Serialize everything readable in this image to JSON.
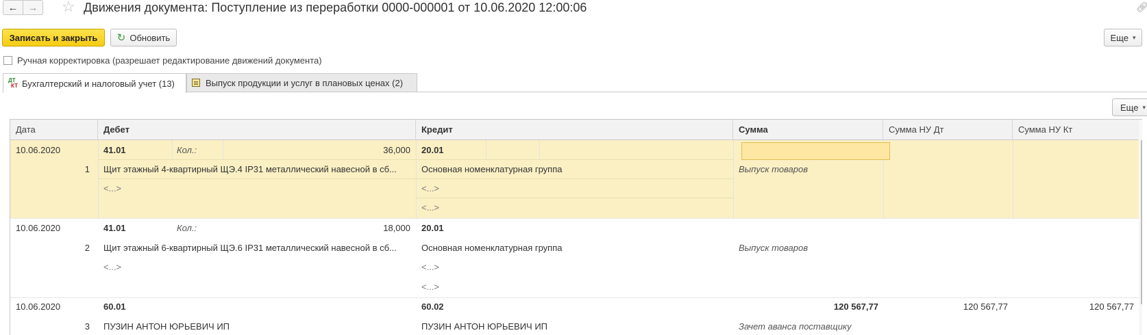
{
  "window": {
    "title": "Движения документа: Поступление из переработки 0000-000001 от 10.06.2020 12:00:06",
    "back_icon": "arrow-left-icon",
    "forward_icon": "arrow-right-icon",
    "favorite_icon": "star-icon",
    "link_icon": "link-icon"
  },
  "toolbar": {
    "save_close_label": "Записать и закрыть",
    "refresh_label": "Обновить",
    "more_label": "Еще"
  },
  "manual_edit": {
    "checked": false,
    "label": "Ручная корректировка (разрешает редактирование движений документа)"
  },
  "tabs": [
    {
      "label": "Бухгалтерский и налоговый учет (13)",
      "icon": "dt-kt-icon",
      "active": true
    },
    {
      "label": "Выпуск продукции и услуг в плановых ценах (2)",
      "icon": "document-icon",
      "active": false
    }
  ],
  "grid": {
    "more_label": "Еще",
    "columns": [
      "Дата",
      "Дебет",
      "Кредит",
      "Сумма",
      "Сумма НУ Дт",
      "Сумма НУ Кт"
    ],
    "rows": [
      {
        "date": "10.06.2020",
        "num": "1",
        "debit_account": "41.01",
        "qty_label": "Кол.:",
        "qty": "36,000",
        "debit_sub1": "Щит этажный 4-квартирный ЩЭ.4 IP31 металлический навесной в сб...",
        "debit_sub2": "<...>",
        "credit_account": "20.01",
        "credit_sub1": "Основная номенклатурная группа",
        "credit_sub2": "<...>",
        "credit_sub3": "<...>",
        "sum": "",
        "sum_desc": "Выпуск товаров",
        "nu_dt": "",
        "nu_kt": ""
      },
      {
        "date": "10.06.2020",
        "num": "2",
        "debit_account": "41.01",
        "qty_label": "Кол.:",
        "qty": "18,000",
        "debit_sub1": "Щит этажный 6-квартирный ЩЭ.6 IP31 металлический навесной в сб...",
        "debit_sub2": "<...>",
        "credit_account": "20.01",
        "credit_sub1": "Основная номенклатурная группа",
        "credit_sub2": "<...>",
        "credit_sub3": "<...>",
        "sum": "",
        "sum_desc": "Выпуск товаров",
        "nu_dt": "",
        "nu_kt": ""
      },
      {
        "date": "10.06.2020",
        "num": "3",
        "debit_account": "60.01",
        "debit_sub1": "ПУЗИН АНТОН ЮРЬЕВИЧ ИП",
        "credit_account": "60.02",
        "credit_sub1": "ПУЗИН АНТОН ЮРЬЕВИЧ ИП",
        "sum": "120 567,77",
        "sum_desc": "Зачет аванса поставщику",
        "nu_dt": "120 567,77",
        "nu_kt": "120 567,77"
      }
    ]
  }
}
